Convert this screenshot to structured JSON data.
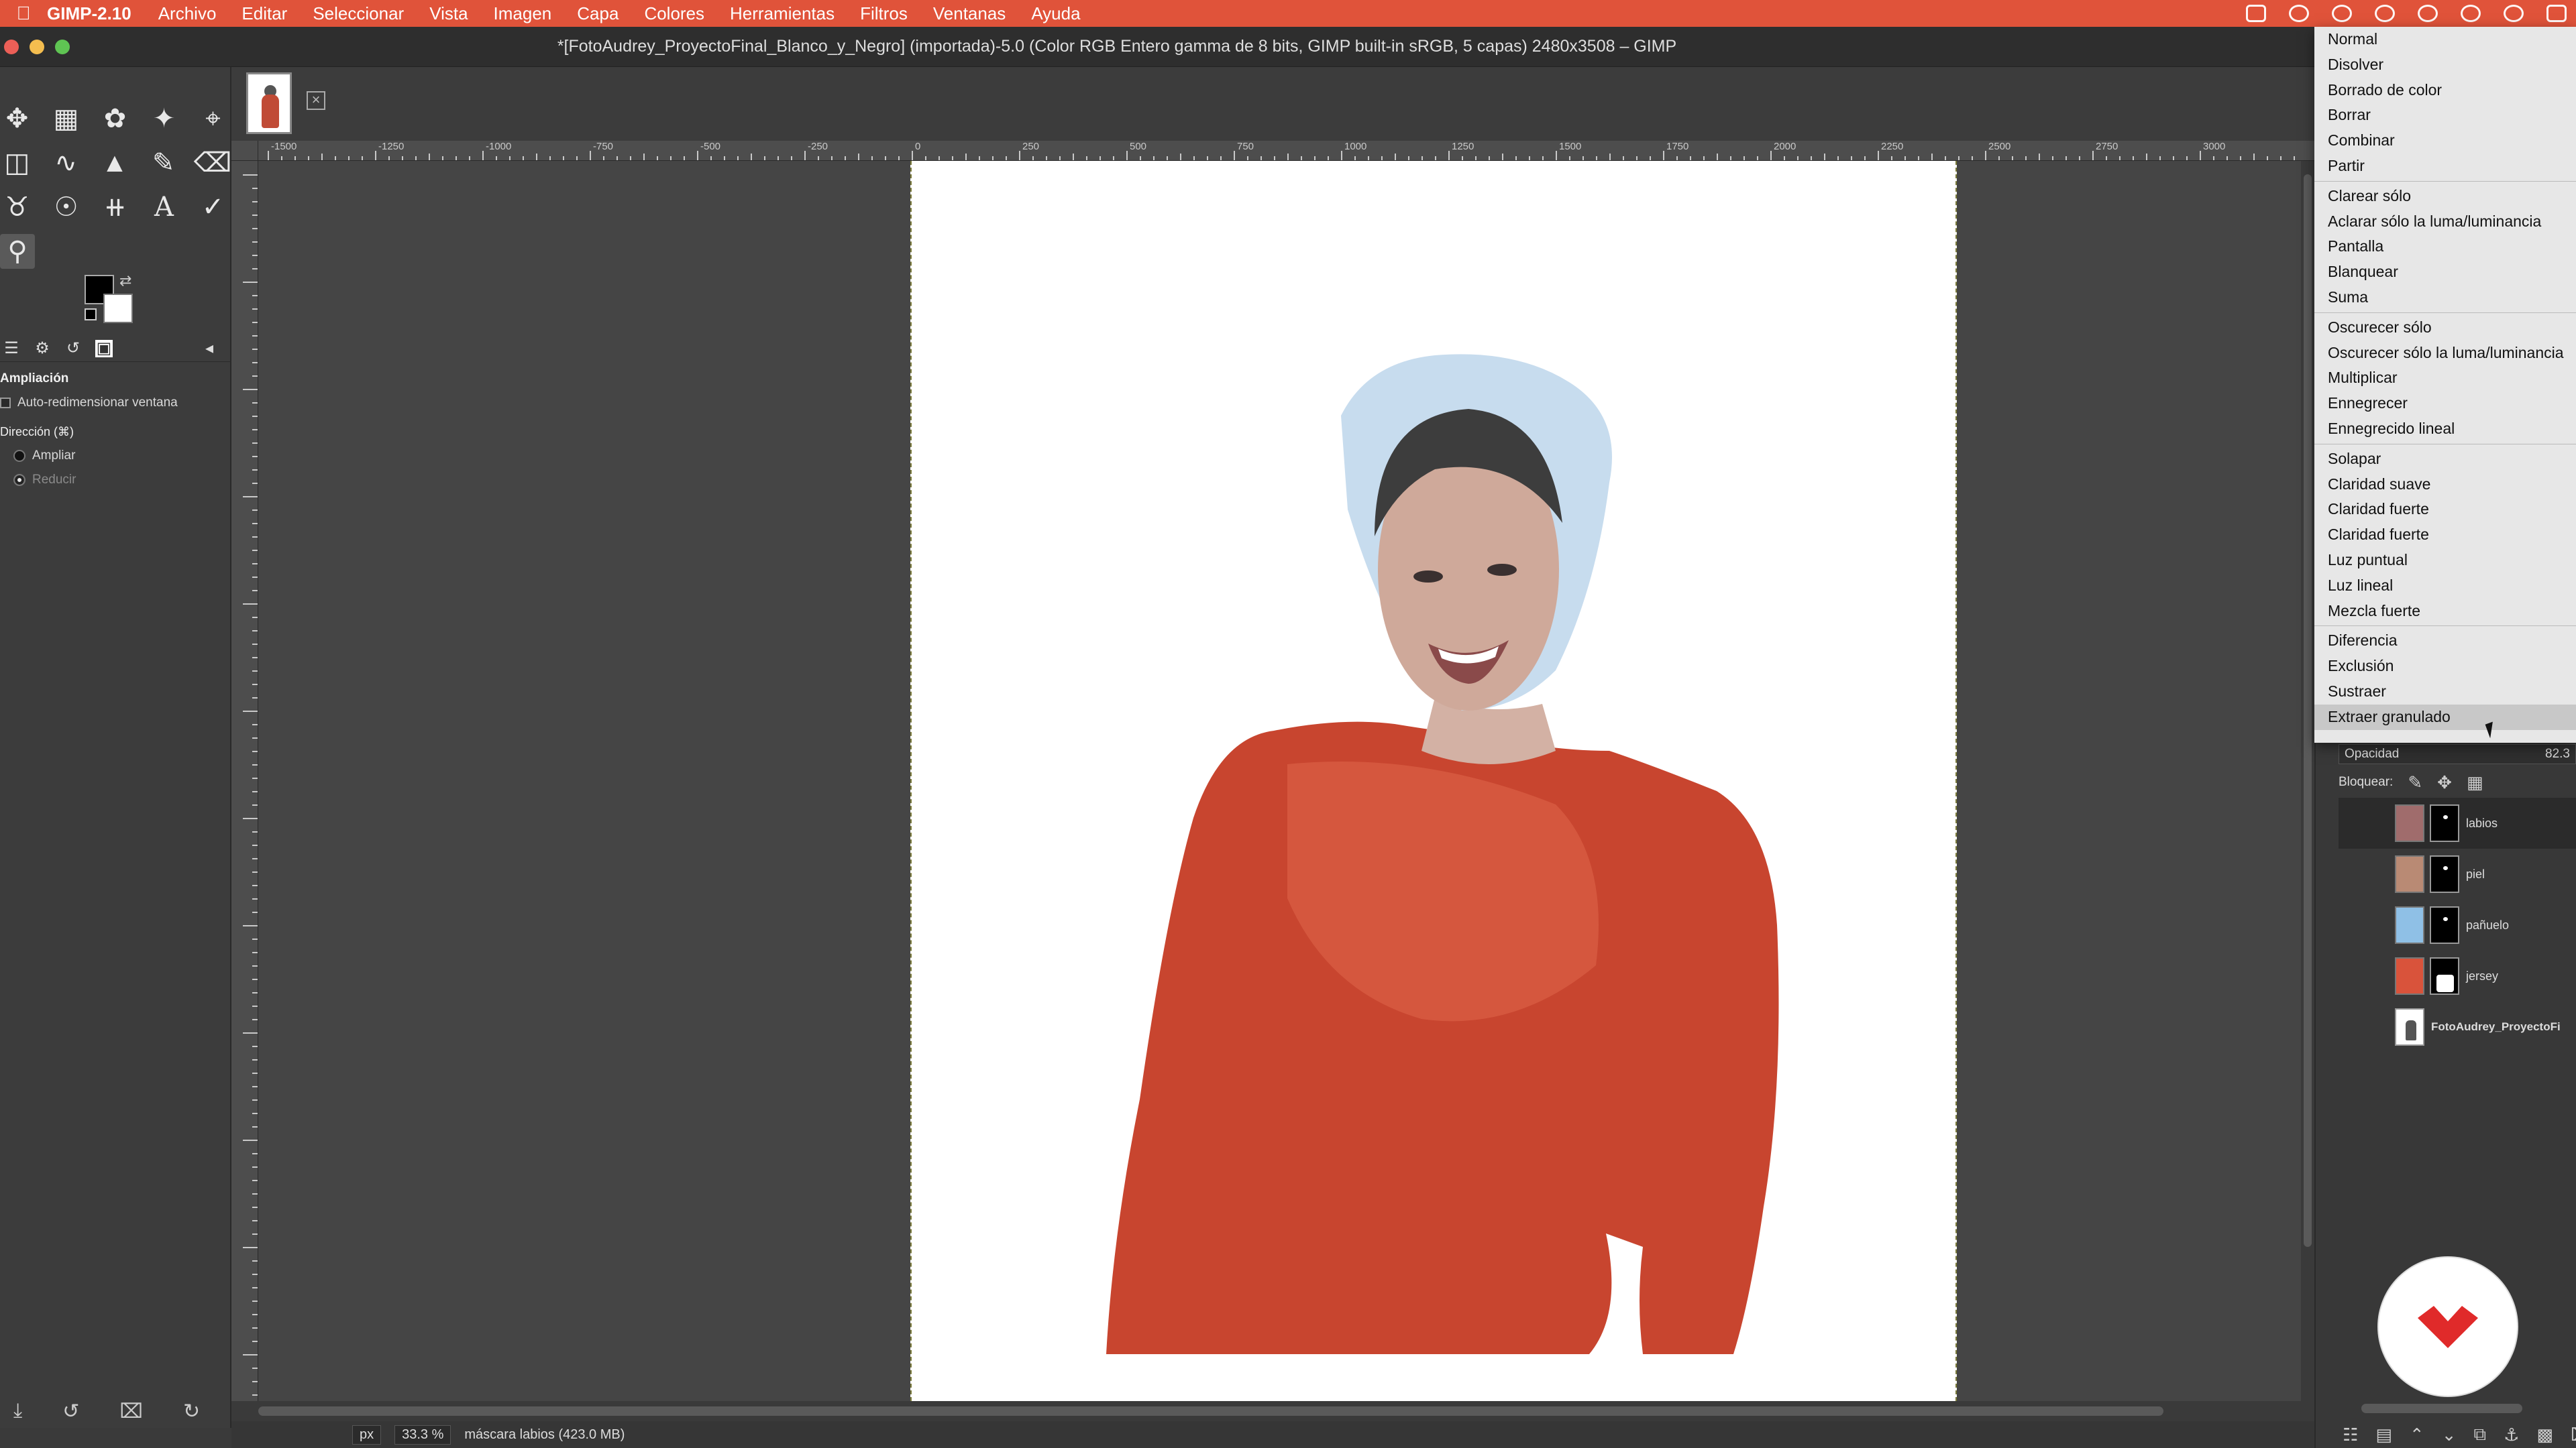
{
  "os_menubar": {
    "app_name": "GIMP-2.10",
    "menus": [
      "Archivo",
      "Editar",
      "Seleccionar",
      "Vista",
      "Imagen",
      "Capa",
      "Colores",
      "Herramientas",
      "Filtros",
      "Ventanas",
      "Ayuda"
    ]
  },
  "window": {
    "title": "*[FotoAudrey_ProyectoFinal_Blanco_y_Negro] (importada)-5.0 (Color RGB Entero gamma de 8 bits, GIMP built-in sRGB, 5 capas) 2480x3508 – GIMP"
  },
  "tool_options": {
    "title": "Ampliación",
    "auto_resize": "Auto-redimensionar ventana",
    "direction_label": "Dirección (⌘)",
    "options": [
      "Ampliar",
      "Reducir"
    ],
    "selected": "Reducir"
  },
  "ruler": {
    "h_labels": [
      "-1500",
      "-1250",
      "-1000",
      "-750",
      "-500",
      "-250",
      "0",
      "250",
      "500",
      "750",
      "1000",
      "1250",
      "1500",
      "1750",
      "2000",
      "2250",
      "2500",
      "2750",
      "3000"
    ]
  },
  "statusbar": {
    "unit": "px",
    "zoom": "33.3 %",
    "message": "máscara labios (423.0 MB)"
  },
  "blend_menu": {
    "groups": [
      [
        "Normal",
        "Disolver",
        "Borrado de color",
        "Borrar",
        "Combinar",
        "Partir"
      ],
      [
        "Clarear sólo",
        "Aclarar sólo la luma/luminancia",
        "Pantalla",
        "Blanquear",
        "Suma"
      ],
      [
        "Oscurecer sólo",
        "Oscurecer sólo la luma/luminancia",
        "Multiplicar",
        "Ennegrecer",
        "Ennegrecido lineal"
      ],
      [
        "Solapar",
        "Claridad suave",
        "Claridad fuerte",
        "Claridad fuerte",
        "Luz puntual",
        "Luz lineal",
        "Mezcla fuerte"
      ],
      [
        "Diferencia",
        "Exclusión",
        "Sustraer",
        "Extraer granulado"
      ]
    ],
    "highlighted": "Extraer granulado"
  },
  "layers_panel": {
    "opacity_label": "Opacidad",
    "opacity_value": "82.3",
    "lock_label": "Bloquear:",
    "layers": [
      {
        "name": "labios",
        "color": "#a06c6c",
        "active": true
      },
      {
        "name": "piel",
        "color": "#b98a74",
        "active": false
      },
      {
        "name": "pañuelo",
        "color": "#8fc0e6",
        "active": false
      },
      {
        "name": "jersey",
        "color": "#d9533b",
        "active": false
      },
      {
        "name": "FotoAudrey_ProyectoFi",
        "color": "#ffffff",
        "active": false
      }
    ]
  },
  "colors": {
    "menubar": "#e0533a",
    "sweater": "#c8452f",
    "scarf": "#c7dcee",
    "skin": "#cfa99a",
    "logo_red": "#e02a2a"
  }
}
